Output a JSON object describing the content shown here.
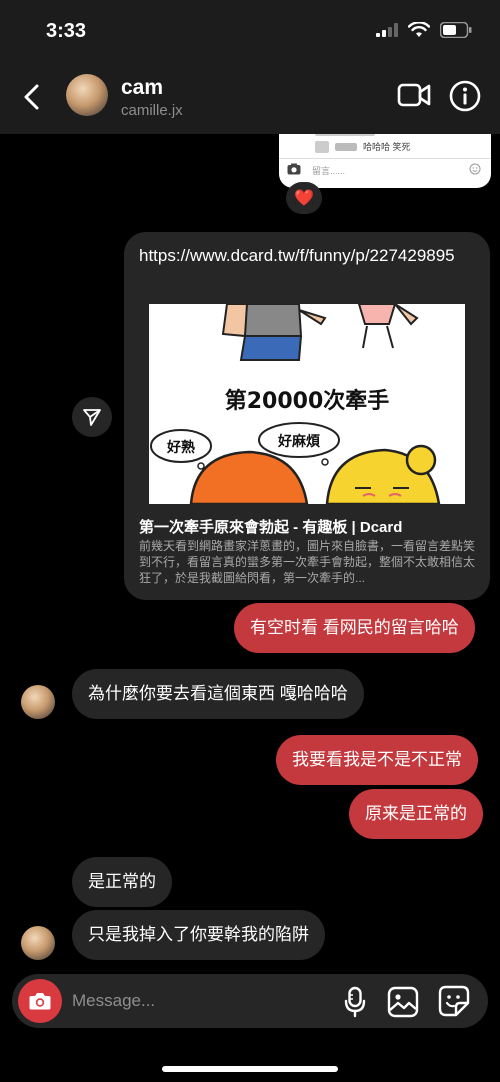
{
  "status_bar": {
    "time": "3:33"
  },
  "header": {
    "name": "cam",
    "username": "camille.jx"
  },
  "shared_screenshot": {
    "comment_text": "哈哈哈 笑死",
    "input_placeholder": "留言......",
    "reaction": "❤️"
  },
  "link_card": {
    "url": "https://www.dcard.tw/f/funny/p/227429895",
    "preview_caption": "第20000次牽手",
    "thought_left": "好熟",
    "thought_right": "好麻煩",
    "title": "第一次牽手原來會勃起 - 有趣板 | Dcard",
    "description": "前幾天看到網路畫家洋蔥畫的，圖片來自臉書，一看留言差點笑到不行，看留言真的蠻多第一次牽手會勃起，整個不太敢相信太狂了，於是我截圖給閃看，第一次牽手的..."
  },
  "messages": [
    {
      "from": "me",
      "text": "有空时看 看网民的留言哈哈"
    },
    {
      "from": "them",
      "text": "為什麼你要去看這個東西 嘎哈哈哈"
    },
    {
      "from": "me",
      "text": "我要看我是不是不正常"
    },
    {
      "from": "me",
      "text": "原来是正常的"
    },
    {
      "from": "them",
      "text": "是正常的"
    },
    {
      "from": "them",
      "text": "只是我掉入了你要幹我的陷阱"
    }
  ],
  "composer": {
    "placeholder": "Message..."
  },
  "colors": {
    "header_bg": "#1c1c1c",
    "my_bubble": "#c4393e",
    "their_bubble": "#262626",
    "camera_button": "#d83a40"
  }
}
